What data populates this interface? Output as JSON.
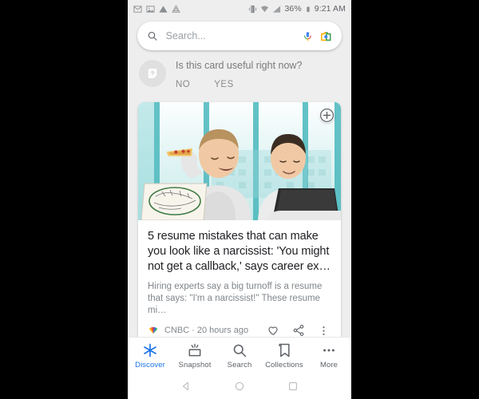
{
  "status_bar": {
    "icons_left": [
      "gmail-icon",
      "photos-icon",
      "drive-triangle-icon",
      "drive-cloud-icon"
    ],
    "icons_right": [
      "vibrate-icon",
      "wifi-icon",
      "signal-icon",
      "battery-icon"
    ],
    "battery_percent": "36%",
    "time": "9:21 AM"
  },
  "search": {
    "placeholder": "Search...",
    "value": "",
    "search_icon": "search-icon",
    "mic_icon": "microphone-icon",
    "lens_icon": "google-lens-icon"
  },
  "feedback": {
    "avatar_icon": "question-card-icon",
    "avatar_glyph": "?",
    "question": "Is this card useful right now?",
    "no_label": "NO",
    "yes_label": "YES"
  },
  "card": {
    "media_alt": "two men at a desk with a laptop, one holding pizza",
    "overlay_button_icon": "add-circle-icon",
    "title": "5 resume mistakes that can make you look like a narcissist: 'You might not get a callback,' says career ex…",
    "description": "Hiring experts say a big turnoff is a resume that says: \"I'm a narcissist!\" These resume mi…",
    "source": "CNBC",
    "separator": "·",
    "timestamp": "20 hours ago",
    "source_logo_icon": "nbc-peacock-icon",
    "actions": [
      {
        "name": "like-icon",
        "label": "Like"
      },
      {
        "name": "share-icon",
        "label": "Share"
      },
      {
        "name": "more-vert-icon",
        "label": "More options"
      }
    ]
  },
  "bottom_nav": {
    "active": "Discover",
    "items": [
      {
        "label": "Discover",
        "icon": "discover-asterisk-icon"
      },
      {
        "label": "Snapshot",
        "icon": "snapshot-icon"
      },
      {
        "label": "Search",
        "icon": "search-icon"
      },
      {
        "label": "Collections",
        "icon": "bookmark-icon"
      },
      {
        "label": "More",
        "icon": "more-horiz-icon"
      }
    ]
  },
  "android_nav": {
    "back": "back-triangle-icon",
    "home": "home-circle-icon",
    "recents": "recents-square-icon"
  },
  "colors": {
    "accent": "#1a73e8",
    "google_blue": "#4285f4",
    "google_red": "#ea4335",
    "google_yellow": "#fbbc04",
    "google_green": "#34a853",
    "background": "#eeeeee",
    "surface": "#ffffff",
    "text_primary": "#202124",
    "text_secondary": "#80868b"
  }
}
